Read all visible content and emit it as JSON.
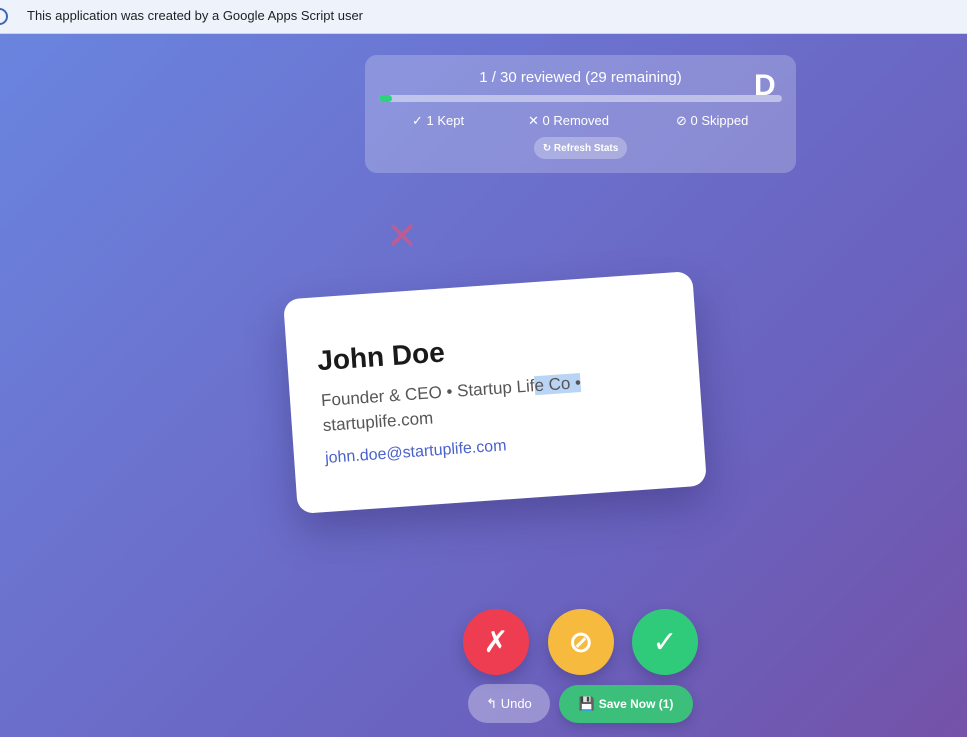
{
  "banner": {
    "text": "This application was created by a Google Apps Script user",
    "icon": "info-icon"
  },
  "stats": {
    "title": "1 / 30 reviewed (29 remaining)",
    "letter": "D",
    "progress_percent": 3.3,
    "kept": "✓ 1 Kept",
    "removed": "✕ 0 Removed",
    "skipped": "⊘ 0 Skipped",
    "refresh_label": "↻ Refresh Stats"
  },
  "swipe_hint": {
    "icon": "remove-x-icon",
    "glyph": "✕"
  },
  "card": {
    "name": "John Doe",
    "line1_before": "Founder & CEO • Startup Lif",
    "line1_selected": "e Co •",
    "line2": "startuplife.com",
    "email": "john.doe@startuplife.com"
  },
  "actions": {
    "remove_glyph": "✗",
    "skip_glyph": "⊘",
    "keep_glyph": "✓",
    "undo_label": "↰ Undo",
    "save_icon": "💾",
    "save_label": "Save Now (1)"
  },
  "colors": {
    "remove": "#ee3d51",
    "skip": "#f6ba3f",
    "keep": "#30cb7a",
    "progress": "#2fd27c",
    "link": "#4a62c9"
  }
}
